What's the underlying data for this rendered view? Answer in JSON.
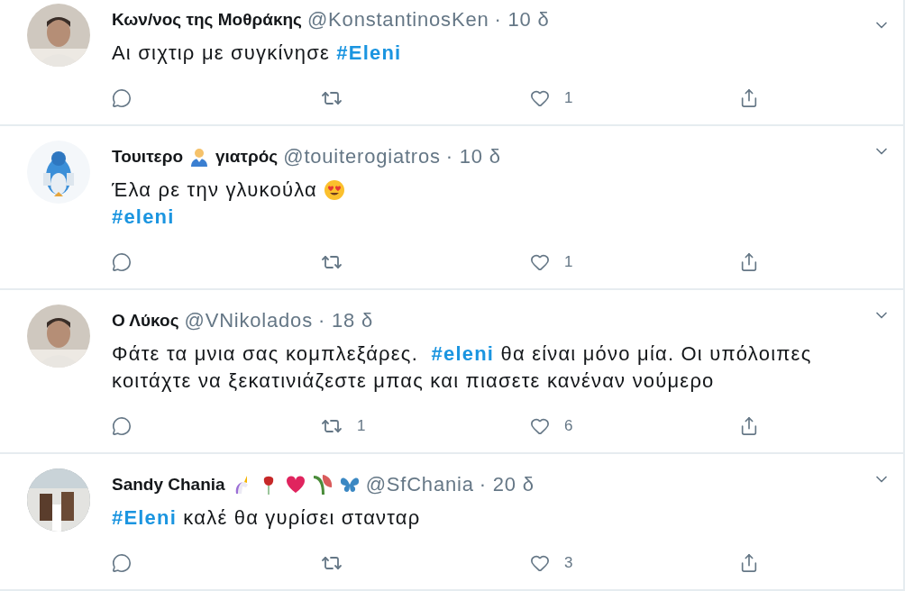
{
  "tweets": [
    {
      "name": [
        {
          "kind": "text",
          "text": "Κων/νος της Μοθράκης"
        }
      ],
      "handle": "@KonstantinosKen",
      "time": "· 10 δ",
      "lines": [
        [
          {
            "kind": "text",
            "text": "Αι σιχτιρ με συγκίνησε "
          },
          {
            "kind": "hashtag",
            "text": "#Eleni"
          }
        ]
      ],
      "likes": "1"
    },
    {
      "name": [
        {
          "kind": "text",
          "text": "Τουιτερο"
        },
        {
          "kind": "doctor"
        },
        {
          "kind": "text",
          "text": "γιατρός"
        }
      ],
      "handle": "@touiterogiatros",
      "time": "· 10 δ",
      "lines": [
        [
          {
            "kind": "text",
            "text": "Έλα ρε την γλυκούλα "
          },
          {
            "kind": "heart-eyes"
          }
        ],
        [
          {
            "kind": "hashtag",
            "text": "#eleni"
          }
        ]
      ],
      "likes": "1"
    },
    {
      "name": [
        {
          "kind": "text",
          "text": "Ο Λύκος"
        }
      ],
      "handle": "@VNikolados",
      "time": "· 18 δ",
      "lines": [
        [
          {
            "kind": "text",
            "text": "Φάτε τα μνια σας κομπλεξάρες.  "
          },
          {
            "kind": "hashtag",
            "text": "#eleni"
          },
          {
            "kind": "text",
            "text": " θα είναι μόνο μία. Οι υπόλοιπες"
          }
        ],
        [
          {
            "kind": "text",
            "text": "κοιτάχτε να ξεκατινιάζεστε μπας και πιασετε κανέναν νούμερο"
          }
        ]
      ],
      "retweets": "1",
      "likes": "6"
    },
    {
      "name": [
        {
          "kind": "text",
          "text": "Sandy Chania"
        },
        {
          "kind": "unicorn"
        },
        {
          "kind": "rose"
        },
        {
          "kind": "heart"
        },
        {
          "kind": "wilted-flower"
        },
        {
          "kind": "butterfly"
        }
      ],
      "handle": "@SfChania",
      "time": "· 20 δ",
      "lines": [
        [
          {
            "kind": "hashtag",
            "text": "#Eleni"
          },
          {
            "kind": "text",
            "text": " καλέ θα γυρίσει στανταρ"
          }
        ]
      ],
      "likes": "3"
    }
  ]
}
